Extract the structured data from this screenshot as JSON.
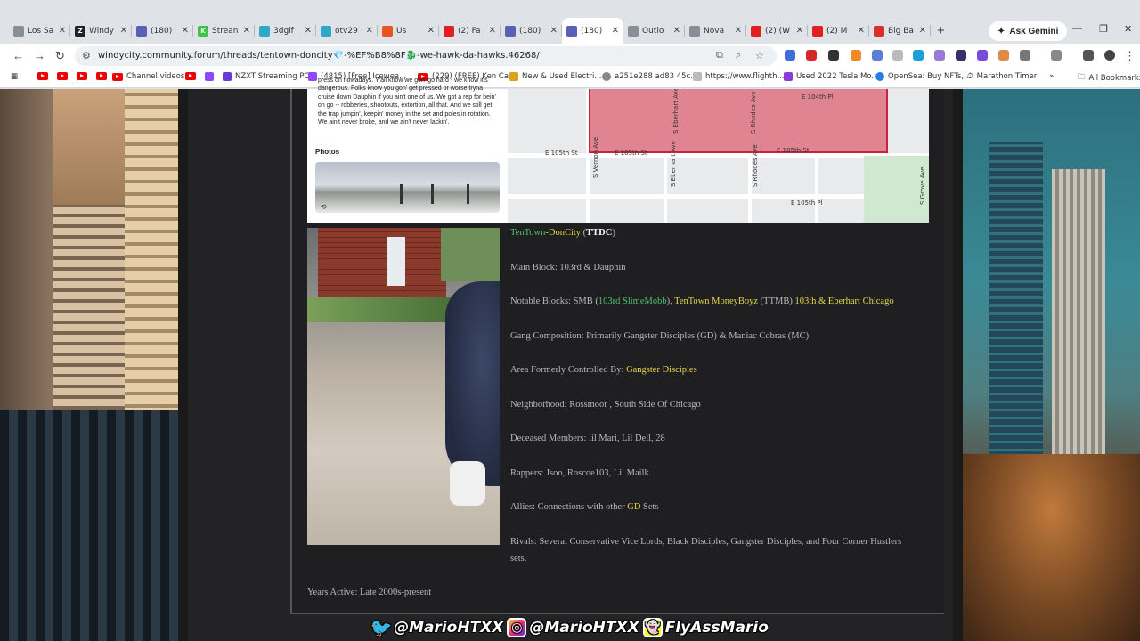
{
  "tabs": [
    {
      "label": "Los Sa",
      "color": "#8a8f96",
      "glyph": ""
    },
    {
      "label": "Windy",
      "color": "#222222",
      "glyph": "Z"
    },
    {
      "label": "(180)",
      "color": "#5a5fb8",
      "glyph": ""
    },
    {
      "label": "Strean",
      "color": "#3ec24a",
      "glyph": "K"
    },
    {
      "label": "3dgif",
      "color": "#2fa8c8",
      "glyph": ""
    },
    {
      "label": "otv29",
      "color": "#2fa8c8",
      "glyph": ""
    },
    {
      "label": "Us",
      "color": "#e8561d",
      "glyph": ""
    },
    {
      "label": "(2) Fa",
      "color": "#e02020",
      "glyph": ""
    },
    {
      "label": "(180)",
      "color": "#5a5fb8",
      "glyph": ""
    },
    {
      "label": "(180)",
      "color": "#5a5fb8",
      "glyph": ""
    },
    {
      "label": "Outlo",
      "color": "#8a8f96",
      "glyph": ""
    },
    {
      "label": "Nova",
      "color": "#8a8f96",
      "glyph": ""
    },
    {
      "label": "(2) (W",
      "color": "#e02020",
      "glyph": ""
    },
    {
      "label": "(2) M",
      "color": "#e02020",
      "glyph": ""
    },
    {
      "label": "Big Ba",
      "color": "#d93025",
      "glyph": ""
    }
  ],
  "active_tab_index": 9,
  "ask_gemini": "Ask Gemini",
  "url": "windycity.community.forum/threads/tentown-doncity💎-%EF%B8%8F🐉-we-hawk-da-hawks.46268/",
  "bookmarks": {
    "channel_videos": "Channel videos",
    "nzxt": "NZXT Streaming PC",
    "iceweasel": "(4815) [Free] Icewea...",
    "kencarson": "(229) (FREE) Ken Car...",
    "electric": "New & Used Electri...",
    "hash": "a251e288 ad83 45c...",
    "flighth": "https://www.flighth...",
    "tesla": "Used 2022 Tesla Mo...",
    "opensea": "OpenSea: Buy NFTs,...",
    "marathon": "Marathon Timer",
    "all": "All Bookmarks"
  },
  "embed": {
    "text": "press on nowadays. Y'all know we gon' go hard - we know it's dangerous. Folks know you gon' get pressed or worse tryna cruise down Dauphin if you ain't one of us. We got a rep for bein' on go -- robberies, shootouts, extortion, all that. And we still get the trap jumpin', keepin' money in the set and poles in rotation. We ain't never broke, and we ain't never lackin'.",
    "photos_heading": "Photos"
  },
  "map_labels": {
    "e104": "E 104th Pl",
    "e105st_l": "E 105th St",
    "e105st_r": "E 105th St",
    "e105st_m": "E 105th St",
    "e105pl": "E 105th Pl",
    "vernon": "S Vernon Ave",
    "eberhart": "S Eberhart Ave",
    "rhodes": "S Rhodes Ave",
    "rhodes2": "S Rhodes Ave",
    "grove": "S Grove Ave",
    "eberhart2": "S Eberhart Ave"
  },
  "info": {
    "title_part1": "TenTown",
    "title_sep": "-",
    "title_part2": "DonCity",
    "title_open": " (",
    "title_abbr": "TTDC",
    "title_close": ")",
    "main_block": "Main Block: 103rd & Dauphin",
    "notable_prefix": "Notable Blocks: SMB (",
    "notable_smb": "103rd SlimeMobb",
    "notable_mid": "), ",
    "notable_ttmb": "TenTown MoneyBoyz",
    "notable_ttmb_abbr": " (TTMB) ",
    "notable_eberhart": "103th & Eberhart Chicago",
    "composition": "Gang Composition: Primarily Gangster Disciples (GD) & Maniac Cobras (MC)",
    "formerly_prefix": "Area Formerly Controlled By: ",
    "formerly_link": "Gangster Disciples",
    "neighborhood": "Neighborhood: Rossmoor , South Side Of Chicago",
    "deceased": "Deceased Members: lil Mari, Lil Dell, 28",
    "rappers": "Rappers: Jsoo, Roscoe103, Lil Mailk.",
    "allies_prefix": "Allies: Connections with other ",
    "allies_gd": "GD",
    "allies_suffix": " Sets",
    "rivals_line1": "Rivals: Several Conservative Vice Lords, Black Disciples, Gangster Disciples, and Four Corner Hustlers",
    "rivals_line2": "sets.",
    "years": "Years Active: Late 2000s-present"
  },
  "social": {
    "twitter": "@MarioHTXX",
    "instagram": "@MarioHTXX",
    "snapchat": "FlyAssMario"
  }
}
